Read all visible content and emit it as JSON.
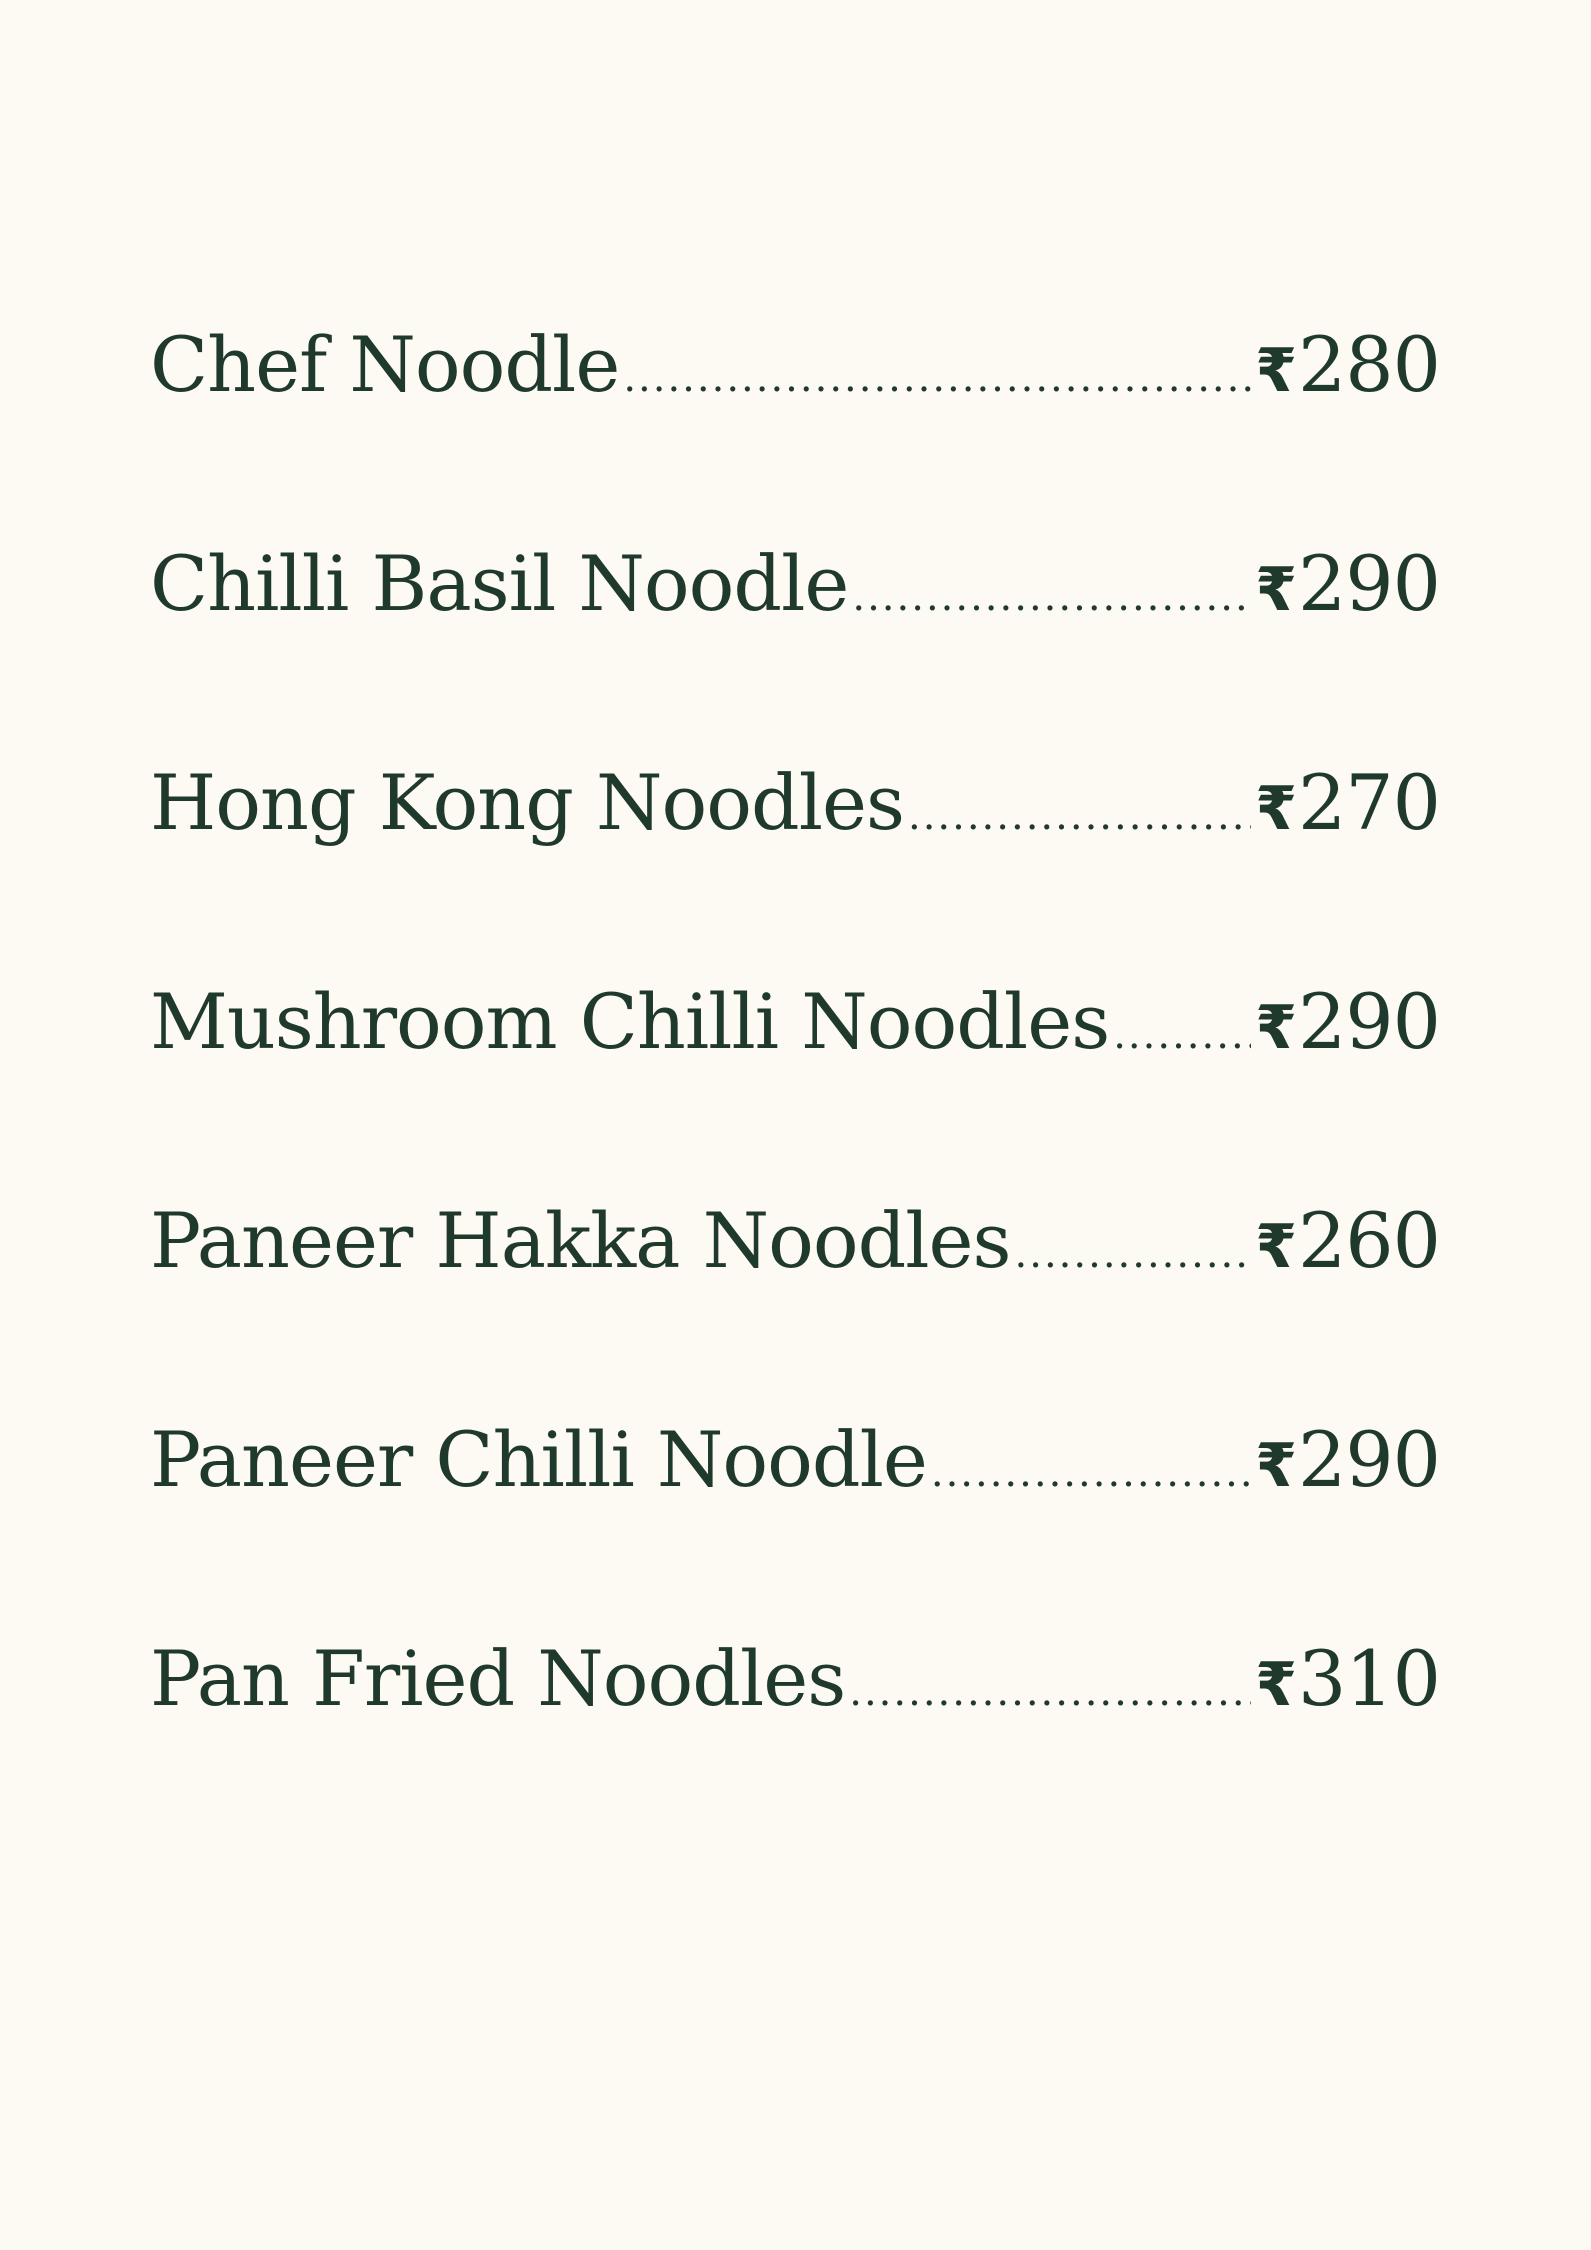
{
  "currency_symbol": "₹",
  "colors": {
    "background": "#fdf9f3",
    "text": "#1f3a2c"
  },
  "menu": {
    "items": [
      {
        "name": "Chef Noodle",
        "price": "280"
      },
      {
        "name": "Chilli Basil Noodle",
        "price": "290"
      },
      {
        "name": "Hong Kong Noodles",
        "price": "270"
      },
      {
        "name": "Mushroom Chilli Noodles",
        "price": "290"
      },
      {
        "name": "Paneer Hakka Noodles",
        "price": "260"
      },
      {
        "name": "Paneer Chilli Noodle",
        "price": "290"
      },
      {
        "name": "Pan Fried Noodles",
        "price": "310"
      }
    ]
  }
}
